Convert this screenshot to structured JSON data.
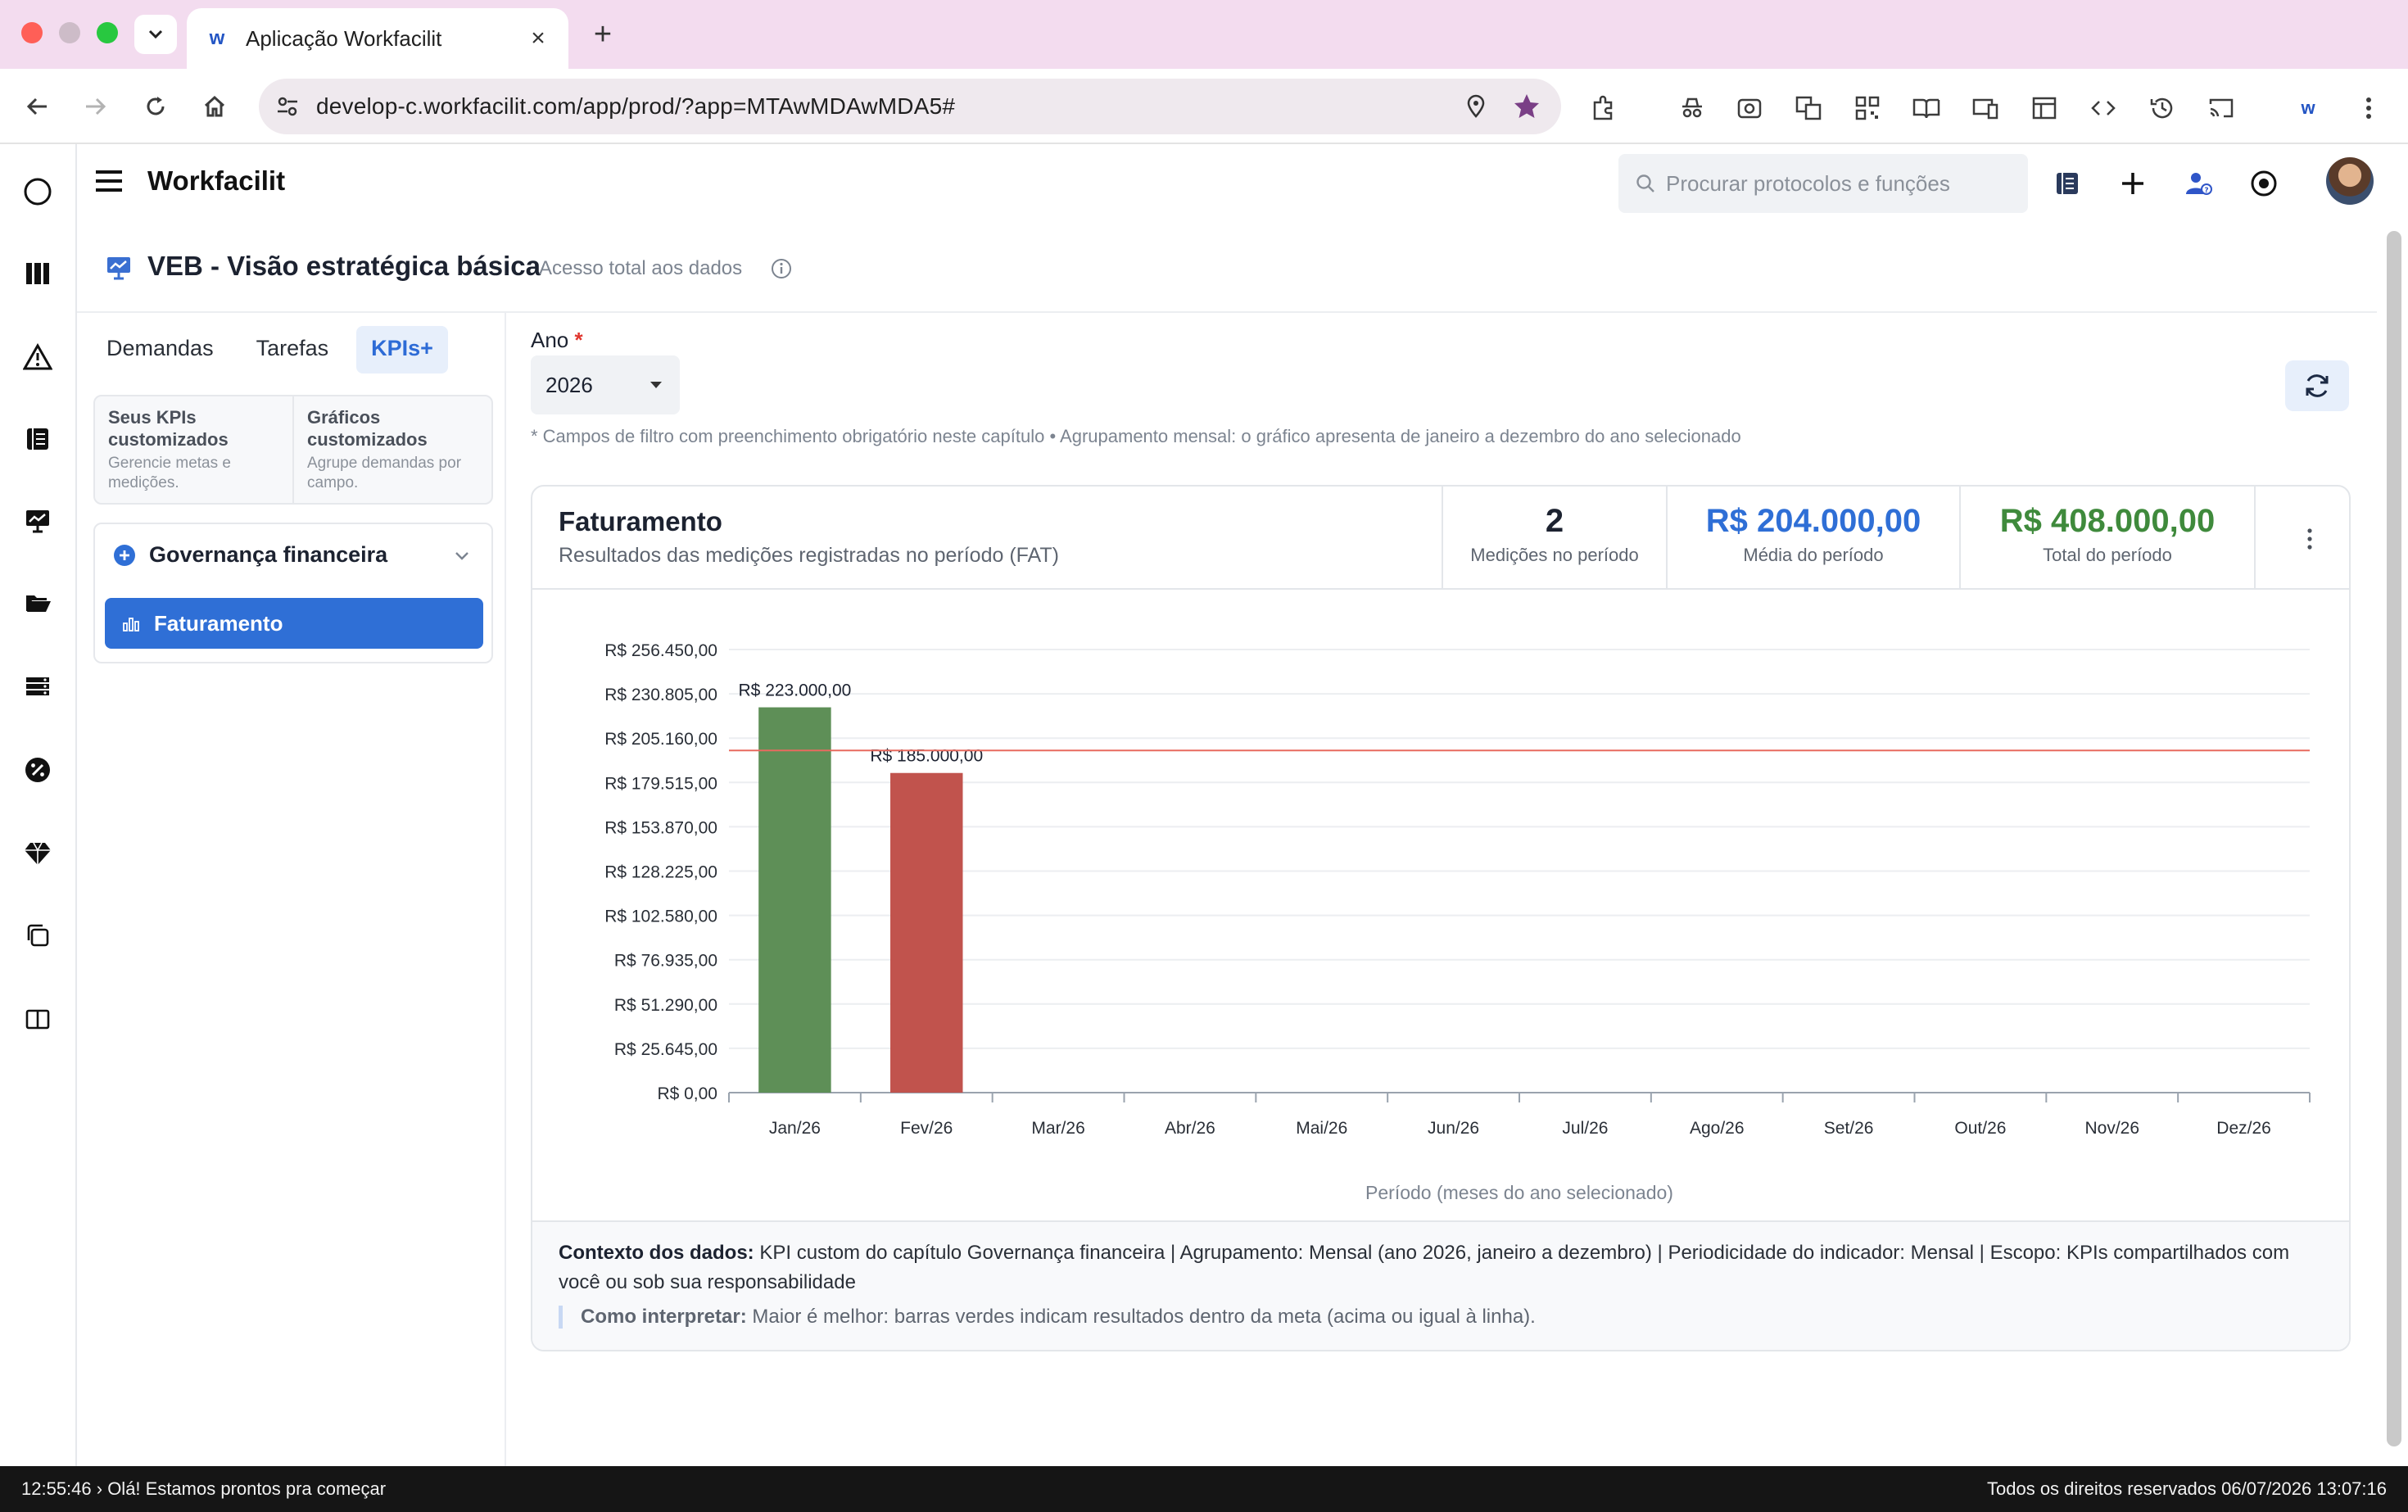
{
  "browser": {
    "tab_title": "Aplicação Workfacilit",
    "url": "develop-c.workfacilit.com/app/prod/?app=MTAwMDAwMDA5#"
  },
  "app": {
    "brand": "Workfacilit",
    "search_placeholder": "Procurar protocolos e funções"
  },
  "page": {
    "title": "VEB - Visão estratégica básica",
    "subtitle": "Acesso total aos dados"
  },
  "tabs": [
    {
      "label": "Demandas",
      "active": false
    },
    {
      "label": "Tarefas",
      "active": false
    },
    {
      "label": "KPIs+",
      "active": true
    }
  ],
  "cards": [
    {
      "title": "Seus KPIs customizados",
      "desc": "Gerencie metas e medições."
    },
    {
      "title": "Gráficos customizados",
      "desc": "Agrupe demandas por campo."
    }
  ],
  "group": {
    "title": "Governança financeira",
    "item": "Faturamento"
  },
  "filter": {
    "label": "Ano",
    "required_mark": "*",
    "value": "2026",
    "note": "* Campos de filtro com preenchimento obrigatório neste capítulo • Agrupamento mensal: o gráfico apresenta de janeiro a dezembro do ano selecionado"
  },
  "panel": {
    "title": "Faturamento",
    "subtitle": "Resultados das medições registradas no período (FAT)",
    "stats": [
      {
        "value": "2",
        "label": "Medições no período",
        "color": "#1c2230"
      },
      {
        "value": "R$ 204.000,00",
        "label": "Média do período",
        "color": "#2f6fd6"
      },
      {
        "value": "R$ 408.000,00",
        "label": "Total do período",
        "color": "#3f8a3c"
      }
    ],
    "context_label": "Contexto dos dados:",
    "context_text": "KPI custom do capítulo Governança financeira | Agrupamento: Mensal (ano 2026, janeiro a dezembro) | Periodicidade do indicador: Mensal | Escopo: KPIs compartilhados com você ou sob sua responsabilidade",
    "hint_label": "Como interpretar:",
    "hint_text": "Maior é melhor: barras verdes indicam resultados dentro da meta (acima ou igual à linha)."
  },
  "chart_data": {
    "type": "bar",
    "categories": [
      "Jan/26",
      "Fev/26",
      "Mar/26",
      "Abr/26",
      "Mai/26",
      "Jun/26",
      "Jul/26",
      "Ago/26",
      "Set/26",
      "Out/26",
      "Nov/26",
      "Dez/26"
    ],
    "values": [
      223000,
      185000,
      null,
      null,
      null,
      null,
      null,
      null,
      null,
      null,
      null,
      null
    ],
    "value_labels": [
      "R$ 223.000,00",
      "R$ 185.000,00"
    ],
    "bar_colors": [
      "#5e8f57",
      "#c1534d"
    ],
    "target": 198000,
    "target_color": "#e86a5f",
    "xlabel": "Período (meses do ano selecionado)",
    "ylim": [
      0,
      256450
    ],
    "yticks": [
      0,
      25645,
      51290,
      76935,
      102580,
      128225,
      153870,
      179515,
      205160,
      230805,
      256450
    ],
    "ytick_labels": [
      "R$ 0,00",
      "R$ 25.645,00",
      "R$ 51.290,00",
      "R$ 76.935,00",
      "R$ 102.580,00",
      "R$ 128.225,00",
      "R$ 153.870,00",
      "R$ 179.515,00",
      "R$ 205.160,00",
      "R$ 230.805,00",
      "R$ 256.450,00"
    ],
    "grid": true
  },
  "status_bar": {
    "left": "12:55:46 › Olá! Estamos prontos pra começar",
    "right": "Todos os direitos reservados 06/07/2026 13:07:16"
  }
}
